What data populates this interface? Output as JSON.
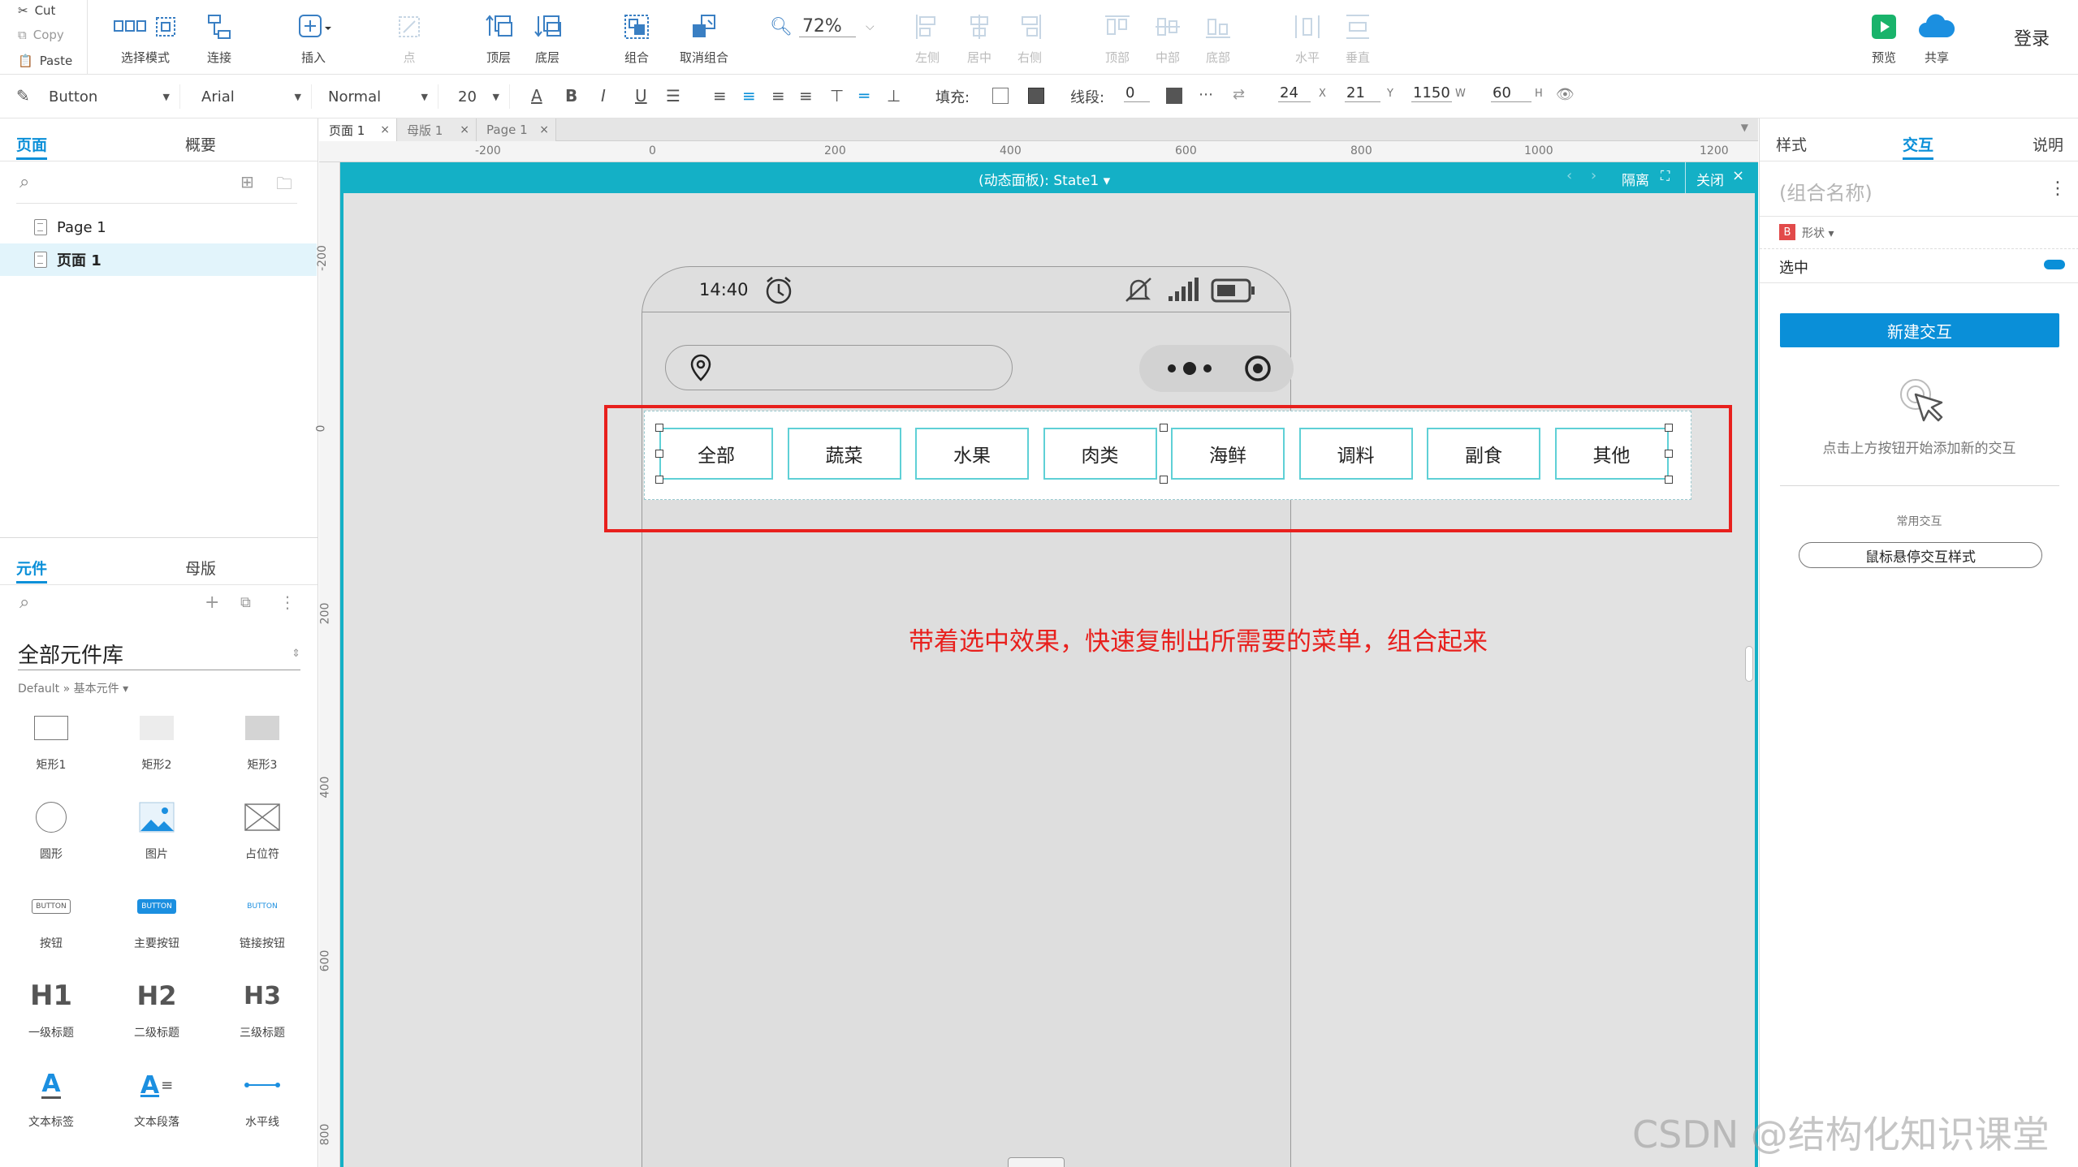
{
  "clipboard": {
    "cut": "Cut",
    "copy": "Copy",
    "paste": "Paste"
  },
  "toolbar": {
    "select_mode": "选择模式",
    "connect": "连接",
    "insert": "插入",
    "point": "点",
    "to_front": "顶层",
    "to_back": "底层",
    "group": "组合",
    "ungroup": "取消组合",
    "zoom": "72%",
    "align_left": "左侧",
    "align_center": "居中",
    "align_right": "右侧",
    "align_top": "顶部",
    "align_middle": "中部",
    "align_bottom": "底部",
    "distribute_h": "水平",
    "distribute_v": "垂直",
    "preview": "预览",
    "share": "共享",
    "login": "登录"
  },
  "format": {
    "widget_type": "Button",
    "font": "Arial",
    "weight": "Normal",
    "size": "20",
    "fill_label": "填充:",
    "stroke_label": "线段:",
    "stroke_value": "0",
    "x": "24",
    "x_unit": "X",
    "y": "21",
    "y_unit": "Y",
    "w": "1150",
    "w_unit": "W",
    "h": "60",
    "h_unit": "H"
  },
  "left_panel": {
    "tabs": [
      "页面",
      "概要"
    ],
    "pages": [
      "Page 1",
      "页面 1"
    ],
    "lib_tabs": [
      "元件",
      "母版"
    ],
    "library_name": "全部元件库",
    "library_path": "Default » 基本元件 ▾",
    "widgets": [
      "矩形1",
      "矩形2",
      "矩形3",
      "圆形",
      "图片",
      "占位符",
      "按钮",
      "主要按钮",
      "链接按钮",
      "一级标题",
      "二级标题",
      "三级标题",
      "文本标签",
      "文本段落",
      "水平线"
    ],
    "widget_icon_text": {
      "button": "BUTTON",
      "h1": "H1",
      "h2": "H2",
      "h3": "H3",
      "text_a": "A"
    }
  },
  "doc_tabs": [
    {
      "label": "页面 1",
      "active": true
    },
    {
      "label": "母版 1",
      "active": false
    },
    {
      "label": "Page 1",
      "active": false
    }
  ],
  "ruler": {
    "h_ticks": [
      "-200",
      "0",
      "200",
      "400",
      "600",
      "800",
      "1000",
      "1200"
    ],
    "v_ticks": [
      "-200",
      "0",
      "200",
      "400",
      "600",
      "800"
    ]
  },
  "dynamic_panel": {
    "title": "(动态面板): State1 ▾",
    "isolate": "隔离",
    "close": "关闭"
  },
  "phone": {
    "time": "14:40"
  },
  "menu_items": [
    "全部",
    "蔬菜",
    "水果",
    "肉类",
    "海鲜",
    "调料",
    "副食",
    "其他"
  ],
  "annotation": "带着选中效果，快速复制出所需要的菜单，组合起来",
  "right_panel": {
    "tabs": [
      "样式",
      "交互",
      "说明"
    ],
    "group_placeholder": "(组合名称)",
    "shape_label": "形状 ▾",
    "shape_badge": "B",
    "selected_label": "选中",
    "new_interaction": "新建交互",
    "hint": "点击上方按钮开始添加新的交互",
    "common_label": "常用交互",
    "hover_style": "鼠标悬停交互样式"
  },
  "watermark": "CSDN @结构化知识课堂",
  "colors": {
    "accent": "#0a8fd8",
    "panel_bar": "#14b0c6",
    "annotation": "#e8201d",
    "button_border": "#5fd0d6"
  }
}
